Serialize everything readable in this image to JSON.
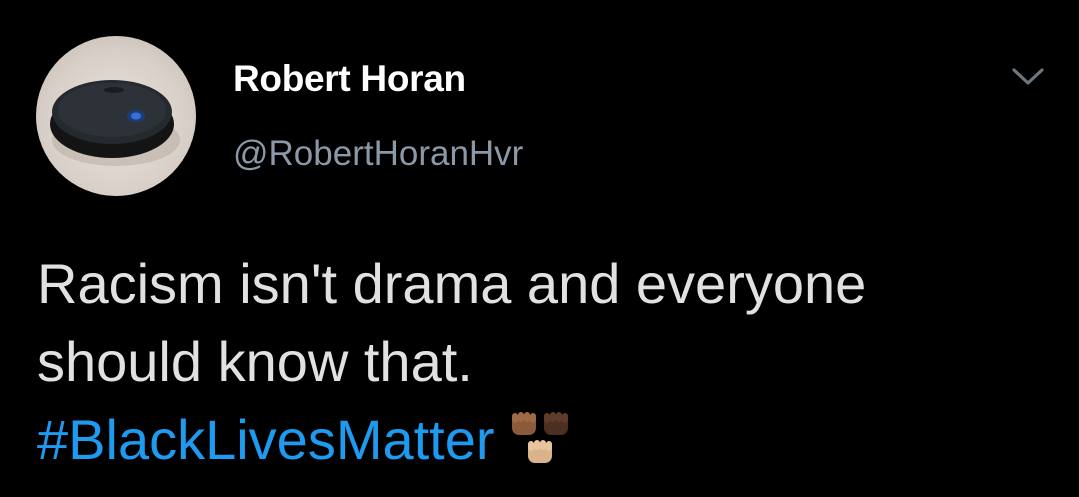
{
  "author": {
    "name": "Robert Horan",
    "handle": "@RobertHoranHvr"
  },
  "tweet": {
    "line1": "Racism isn't drama and everyone",
    "line2": "should know that.",
    "hashtag": "#BlackLivesMatter"
  },
  "icons": {
    "menu": "chevron-down-icon",
    "emoji": "raised-fist-emoji-group"
  },
  "colors": {
    "background": "#000000",
    "name": "#ffffff",
    "handle": "#8b98a5",
    "text": "#e1e1e1",
    "hashtag": "#1d9bf0"
  }
}
